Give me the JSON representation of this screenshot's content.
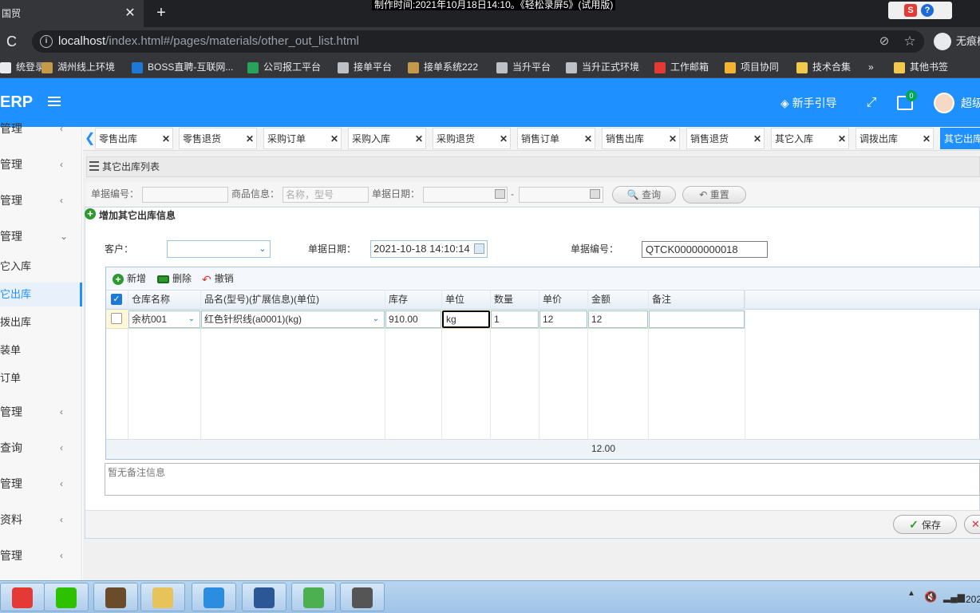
{
  "browser": {
    "tab_title": "国贸",
    "tab_close": "✕",
    "new_tab": "+",
    "recording_banner": "制作时间:2021年10月18日14:10。《轻松录屏5》(试用版)",
    "tray_s": "S",
    "tray_q": "?",
    "reload": "C",
    "info_icon": "i",
    "url_host": "localhost",
    "url_path": "/index.html#/pages/materials/other_out_list.html",
    "incognito_label": "无痕模式",
    "bookmarks": [
      {
        "label": "统登录",
        "color": "#e8eaed"
      },
      {
        "label": "湖州线上环境",
        "color": "#c49a4a"
      },
      {
        "label": "BOSS直聘-互联网...",
        "color": "#1e78d6"
      },
      {
        "label": "公司报工平台",
        "color": "#29a35a"
      },
      {
        "label": "接单平台",
        "color": "#bdc1c6"
      },
      {
        "label": "接单系统222",
        "color": "#c49a4a"
      },
      {
        "label": "当升平台",
        "color": "#bdc1c6"
      },
      {
        "label": "当升正式环境",
        "color": "#bdc1c6"
      },
      {
        "label": "工作邮箱",
        "color": "#e53935"
      },
      {
        "label": "项目协同",
        "color": "#f2b233"
      },
      {
        "label": "技术合集",
        "color": "#f2c94c"
      },
      {
        "label": "»",
        "color": ""
      },
      {
        "label": "其他书签",
        "color": "#f2c94c"
      }
    ]
  },
  "header": {
    "logo": "ERP",
    "guide": "新手引导",
    "guide_icon": "diamond-icon",
    "mail_badge": "0",
    "username": "超级"
  },
  "sidebar": {
    "items": [
      {
        "label": "管理",
        "arrow": "‹"
      },
      {
        "label": "管理",
        "arrow": "‹"
      },
      {
        "label": "管理",
        "arrow": "‹"
      },
      {
        "label": "管理",
        "arrow": "⌄"
      },
      {
        "label": "管理",
        "arrow": "‹"
      },
      {
        "label": "查询",
        "arrow": "‹"
      },
      {
        "label": "管理",
        "arrow": "‹"
      },
      {
        "label": "资料",
        "arrow": "‹"
      },
      {
        "label": "管理",
        "arrow": "‹"
      }
    ],
    "subitems": [
      "它入库",
      "它出库",
      "拨出库",
      "装单",
      "订单"
    ]
  },
  "page_tabs": [
    {
      "label": "零售出库",
      "active": false
    },
    {
      "label": "零售退货",
      "active": false
    },
    {
      "label": "采购订单",
      "active": false
    },
    {
      "label": "采购入库",
      "active": false
    },
    {
      "label": "采购退货",
      "active": false
    },
    {
      "label": "销售订单",
      "active": false
    },
    {
      "label": "销售出库",
      "active": false
    },
    {
      "label": "销售退货",
      "active": false
    },
    {
      "label": "其它入库",
      "active": false
    },
    {
      "label": "调拨出库",
      "active": false
    },
    {
      "label": "其它出库",
      "active": true
    }
  ],
  "tab_close": "✕",
  "panel": {
    "title": "其它出库列表"
  },
  "search": {
    "bill_no_label": "单据编号：",
    "goods_label": "商品信息：",
    "goods_placeholder": "名称，型号",
    "date_label": "单据日期：",
    "date_sep": "-",
    "query_button": "查询",
    "reset_button": "重置"
  },
  "dialog": {
    "title": "增加其它出库信息",
    "customer_label": "客户：",
    "customer_value": "",
    "date_label": "单据日期：",
    "date_value": "2021-10-18 14:10:14",
    "bill_no_label": "单据编号：",
    "bill_no_value": "QTCK00000000018",
    "toolbar": {
      "add": "新增",
      "delete": "删除",
      "undo": "撤销"
    },
    "columns": [
      "仓库名称",
      "品名(型号)(扩展信息)(单位)",
      "库存",
      "单位",
      "数量",
      "单价",
      "金额",
      "备注"
    ],
    "rows": [
      {
        "warehouse": "余杭001",
        "product": "红色针织线(a0001)(kg)",
        "stock": "910.00",
        "unit": "kg",
        "qty": "1",
        "price": "12",
        "amount": "12",
        "remark": ""
      }
    ],
    "total_amount": "12.00",
    "remark_placeholder": "暂无备注信息",
    "save_button": "保存"
  },
  "taskbar": {
    "apps": [
      {
        "icon": "chrome-icon",
        "color": "#e53935"
      },
      {
        "icon": "wechat-icon",
        "color": "#2dc100"
      },
      {
        "icon": "javaee-ide-icon",
        "color": "#6b4c2a"
      },
      {
        "icon": "folder-icon",
        "color": "#e8c25a"
      },
      {
        "icon": "app-icon",
        "color": "#2b8de0"
      },
      {
        "icon": "word-icon",
        "color": "#2b5797"
      },
      {
        "icon": "notepad-icon",
        "color": "#4caf50"
      },
      {
        "icon": "terminal-icon",
        "color": "#555555"
      }
    ],
    "clock": "202"
  }
}
